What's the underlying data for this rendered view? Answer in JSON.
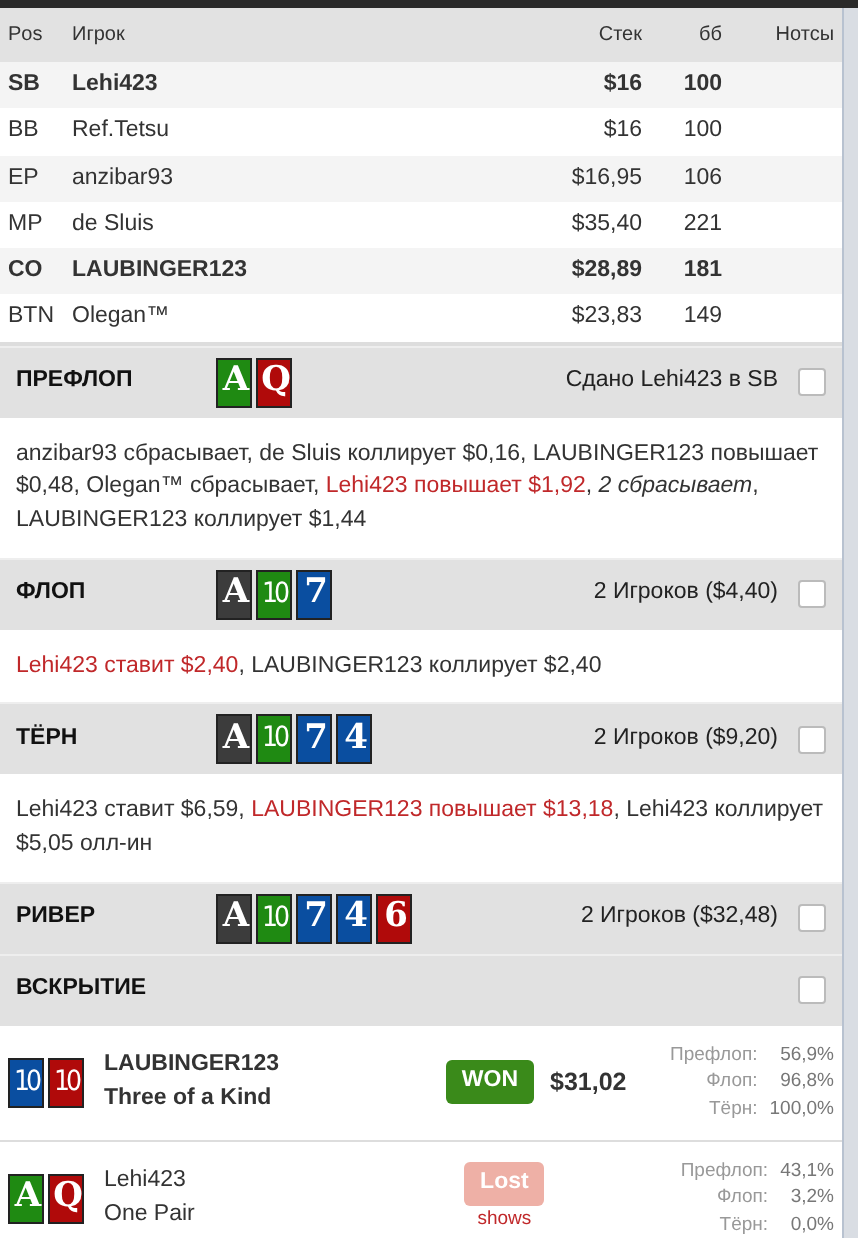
{
  "players_table": {
    "columns": [
      "Pos",
      "Игрок",
      "Стек",
      "бб",
      "Нотсы"
    ],
    "rows": [
      {
        "pos": "SB",
        "name": "Lehi423",
        "stack": "$16",
        "bb": "100",
        "hero": true
      },
      {
        "pos": "BB",
        "name": "Ref.Tetsu",
        "stack": "$16",
        "bb": "100",
        "hero": false
      },
      {
        "pos": "EP",
        "name": "anzibar93",
        "stack": "$16,95",
        "bb": "106",
        "hero": false
      },
      {
        "pos": "MP",
        "name": "de Sluis",
        "stack": "$35,40",
        "bb": "221",
        "hero": false
      },
      {
        "pos": "CO",
        "name": "LAUBINGER123",
        "stack": "$28,89",
        "bb": "181",
        "hero": true
      },
      {
        "pos": "BTN",
        "name": "Olegan™",
        "stack": "$23,83",
        "bb": "149",
        "hero": false
      }
    ]
  },
  "streets": [
    {
      "title": "ПРЕФЛОП",
      "cards": [
        {
          "rank": "A",
          "color": "#1f8a12"
        },
        {
          "rank": "Q",
          "color": "#b00a0a"
        }
      ],
      "info": "Сдано Lehi423 в SB",
      "note_checked": false,
      "actions": [
        {
          "text": "anzibar93 сбрасывает, de Sluis коллирует $0,16, LAUBINGER123 повышает $0,48, Olegan™ сбрасывает, ",
          "highlight": false
        },
        {
          "text": "Lehi423 повышает $1,92",
          "highlight": true
        },
        {
          "text": ", *2 сбрасывает*, LAUBINGER123 коллирует $1,44",
          "highlight": false
        }
      ]
    },
    {
      "title": "ФЛОП",
      "cards": [
        {
          "rank": "A",
          "color": "#3c3c3c"
        },
        {
          "rank": "10",
          "color": "#1f8a12"
        },
        {
          "rank": "7",
          "color": "#0a4ea0"
        }
      ],
      "info": "2 Игроков ($4,40)",
      "note_checked": false,
      "actions": [
        {
          "text": "Lehi423 ставит $2,40",
          "highlight": true
        },
        {
          "text": ", LAUBINGER123 коллирует $2,40",
          "highlight": false
        }
      ]
    },
    {
      "title": "ТЁРН",
      "cards": [
        {
          "rank": "A",
          "color": "#3c3c3c"
        },
        {
          "rank": "10",
          "color": "#1f8a12"
        },
        {
          "rank": "7",
          "color": "#0a4ea0"
        },
        {
          "rank": "4",
          "color": "#0a4ea0"
        }
      ],
      "info": "2 Игроков ($9,20)",
      "note_checked": false,
      "actions": [
        {
          "text": "Lehi423 ставит $6,59, ",
          "highlight": false
        },
        {
          "text": "LAUBINGER123 повышает $13,18",
          "highlight": true
        },
        {
          "text": ", Lehi423 коллирует $5,05 олл-ин",
          "highlight": false
        }
      ]
    },
    {
      "title": "РИВЕР",
      "cards": [
        {
          "rank": "A",
          "color": "#3c3c3c"
        },
        {
          "rank": "10",
          "color": "#1f8a12"
        },
        {
          "rank": "7",
          "color": "#0a4ea0"
        },
        {
          "rank": "4",
          "color": "#0a4ea0"
        },
        {
          "rank": "6",
          "color": "#b00a0a"
        }
      ],
      "info": "2 Игроков ($32,48)",
      "note_checked": false
    },
    {
      "title": "ВСКРЫТИЕ",
      "note_checked": false
    }
  ],
  "showdown": [
    {
      "cards": [
        {
          "rank": "10",
          "color": "#0a4ea0"
        },
        {
          "rank": "10",
          "color": "#b00a0a"
        }
      ],
      "name": "LAUBINGER123",
      "hand": "Three of a Kind",
      "bold": true,
      "result": "WON",
      "kind": "won",
      "amount": "$31,02",
      "equity": [
        {
          "label": "Префлоп:",
          "value": "56,9%"
        },
        {
          "label": "Флоп:",
          "value": "96,8%"
        },
        {
          "label": "Тёрн:",
          "value": "100,0%"
        }
      ]
    },
    {
      "cards": [
        {
          "rank": "A",
          "color": "#1f8a12"
        },
        {
          "rank": "Q",
          "color": "#b00a0a"
        }
      ],
      "name": "Lehi423",
      "hand": "One Pair",
      "bold": false,
      "result": "Lost",
      "kind": "lost",
      "sub": "shows",
      "equity": [
        {
          "label": "Префлоп:",
          "value": "43,1%"
        },
        {
          "label": "Флоп:",
          "value": "3,2%"
        },
        {
          "label": "Тёрн:",
          "value": "0,0%"
        }
      ]
    }
  ]
}
